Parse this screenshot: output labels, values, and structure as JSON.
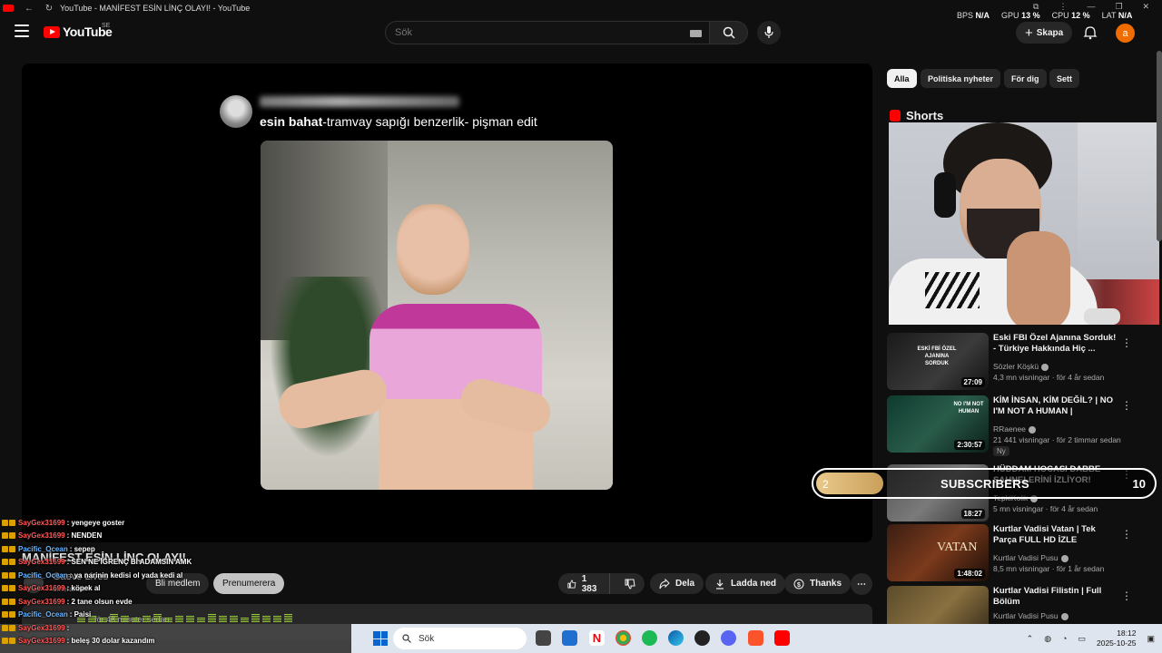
{
  "window": {
    "title": "YouTube - MANİFEST ESİN LİNÇ OLAYI! - YouTube"
  },
  "stats": {
    "bps_label": "BPS",
    "bps_value": "N/A",
    "gpu_label": "GPU",
    "gpu_value": "13 %",
    "cpu_label": "CPU",
    "cpu_value": "12 %",
    "lat_label": "LAT",
    "lat_value": "N/A"
  },
  "header": {
    "logo_text": "YouTube",
    "region": "SE",
    "search_placeholder": "Sök",
    "create_label": "Skapa",
    "avatar_letter": "a"
  },
  "player": {
    "caption_bold": "esin bahat",
    "caption_rest": "-tramvay sapığı benzerlik- pişman edit"
  },
  "video": {
    "title": "MANİFEST ESİN LİNÇ OLAYI!",
    "channel_name": "Gaeve Lives",
    "channel_subs": "umeranter",
    "join_label": "Bli medlem",
    "subscribe_label": "Prenumerera",
    "like_count": "1 383",
    "share_label": "Dela",
    "download_label": "Ladda ned",
    "thanks_label": "Thanks",
    "meta_text": "för 46 minuter sedan"
  },
  "chat": [
    {
      "user": "SayGex31699",
      "message": ": yengeye goster",
      "user_color": "red"
    },
    {
      "user": "SayGex31699",
      "message": ": NENDEN",
      "user_color": "red"
    },
    {
      "user": "Pacific_Ocean",
      "message": ": sepep",
      "user_color": "blue"
    },
    {
      "user": "SayGex31699",
      "message": ": SEN NE İĞRENÇ Bİ ADAMSIN AMK",
      "user_color": "red"
    },
    {
      "user": "Pacific_Ocean",
      "message": ": ya narinin kedisi ol yada kedi al",
      "user_color": "blue"
    },
    {
      "user": "SayGex31699",
      "message": ": köpek al",
      "user_color": "red"
    },
    {
      "user": "SayGex31699",
      "message": ": 2 tane olsun evde",
      "user_color": "red"
    },
    {
      "user": "Pacific_Ocean",
      "message": ": Paisi",
      "user_color": "blue"
    },
    {
      "user": "SayGex31699",
      "message": ":",
      "user_color": "red"
    },
    {
      "user": "SayGex31699",
      "message": ": beleş 30 dolar kazandım",
      "user_color": "red"
    }
  ],
  "sidebar": {
    "chips": [
      "Alla",
      "Politiska nyheter",
      "För dig",
      "Sett"
    ],
    "shorts_label": "Shorts",
    "recommendations": [
      {
        "title": "Eski FBI Özel Ajanına Sorduk! - Türkiye Hakkında Hiç ...",
        "channel": "Sözler Köşkü",
        "meta": "4,3 mn visningar · för 4 år sedan",
        "duration": "27:09",
        "badge": ""
      },
      {
        "title": "KİM İNSAN, KİM DEĞİL? | NO I'M NOT A HUMAN |",
        "channel": "RRaenee",
        "meta": "21 441 visningar · för 2 timmar sedan",
        "duration": "2:30:57",
        "badge": "Ny"
      },
      {
        "title": "HÜDDAM HOCASI DABBE SAHNELERİNİ İZLİYOR!",
        "channel": "TepkiKolik",
        "meta": "5 mn visningar · för 4 år sedan",
        "duration": "18:27",
        "badge": ""
      },
      {
        "title": "Kurtlar Vadisi Vatan | Tek Parça FULL HD İZLE",
        "channel": "Kurtlar Vadisi Pusu",
        "meta": "8,5 mn visningar · för 1 år sedan",
        "duration": "1:48:02",
        "badge": ""
      },
      {
        "title": "Kurtlar Vadisi Filistin | Full Bölüm",
        "channel": "Kurtlar Vadisi Pusu",
        "meta": "",
        "duration": "",
        "badge": ""
      }
    ],
    "thumb_text_1": "ESKİ FBİ ÖZEL AJANINA SORDUK",
    "thumb_text_2": "NO I'M NOT HUMAN",
    "thumb_text_4": "VATAN"
  },
  "sub_goal": {
    "current": "2",
    "label": "SUBSCRIBERS",
    "target": "10",
    "progress_fraction": 0.2
  },
  "taskbar": {
    "search_label": "Sök",
    "time": "18:12",
    "date": "2025-10-25"
  }
}
